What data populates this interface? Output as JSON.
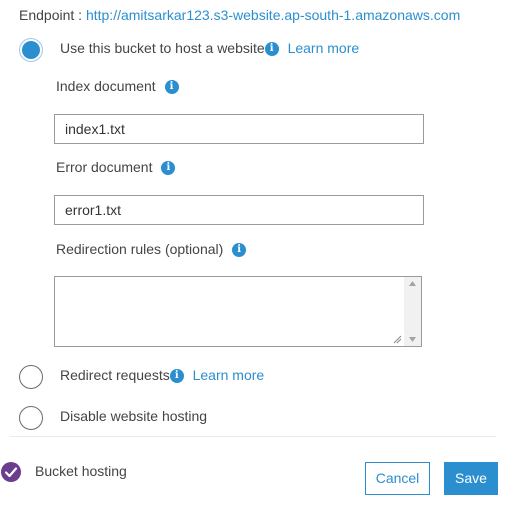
{
  "endpoint": {
    "label": "Endpoint :",
    "url": "http://amitsarkar123.s3-website.ap-south-1.amazonaws.com"
  },
  "options": {
    "host": {
      "label": "Use this bucket to host a website",
      "learn_more": "Learn more",
      "checked": true
    },
    "redirect": {
      "label": "Redirect requests",
      "learn_more": "Learn more",
      "checked": false
    },
    "disable": {
      "label": "Disable website hosting",
      "checked": false
    }
  },
  "form": {
    "index_label": "Index document",
    "index_value": "index1.txt",
    "error_label": "Error document",
    "error_value": "error1.txt",
    "rules_label": "Redirection rules (optional)",
    "rules_value": ""
  },
  "info_glyph": "i",
  "footer": {
    "status_label": "Bucket hosting",
    "cancel": "Cancel",
    "save": "Save"
  },
  "colors": {
    "accent": "#2b8fcf",
    "status_purple": "#6a3d8f",
    "save_bg": "#2b8fcf"
  }
}
